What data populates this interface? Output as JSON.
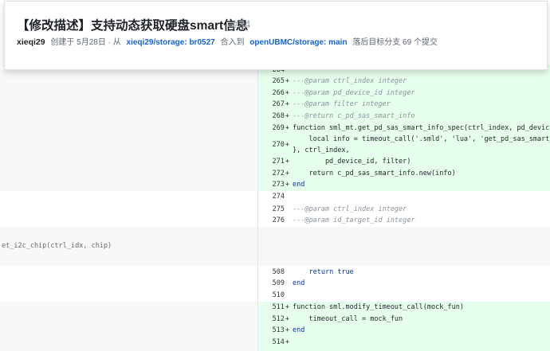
{
  "pr": {
    "title": "【修改描述】支持动态获取硬盘smart信息",
    "number": "#34",
    "author": "xieqi29",
    "created": "创建于 5月28日 · 从",
    "source_branch": "xieqi29/storage: br0527",
    "merge_into": "合入到",
    "target_branch": "openUBMC/storage: main",
    "behind": "落后目标分支 69 个提交"
  },
  "left_code": "et_i2c_chip(ctrl_idx, chip)",
  "hunk1": [
    {
      "ln": "265",
      "code": "---@param ctrl_index integer",
      "type": "comment"
    },
    {
      "ln": "266",
      "code": "---@param pd_device_id integer",
      "type": "comment"
    },
    {
      "ln": "267",
      "code": "---@param filter integer",
      "type": "comment"
    },
    {
      "ln": "268",
      "code": "---@return c_pd_sas_smart_info",
      "type": "comment"
    },
    {
      "ln": "269",
      "code": "function sml_mt.get_pd_sas_smart_info_spec(ctrl_index, pd_device_id, filter)",
      "type": "code"
    },
    {
      "ln": "270",
      "code": "    local info = timeout_call('.smld', 'lua', 'get_pd_sas_smart_info_spec'",
      "code2": "}, ctrl_index,",
      "type": "code"
    },
    {
      "ln": "271",
      "code": "        pd_device_id, filter)",
      "type": "code"
    },
    {
      "ln": "272",
      "code": "    return c_pd_sas_smart_info.new(info)",
      "type": "code"
    },
    {
      "ln": "273",
      "code": "end",
      "type": "code"
    }
  ],
  "context1": [
    {
      "ln": "274",
      "code": ""
    },
    {
      "ln": "275",
      "code": "---@param ctrl_index integer",
      "type": "comment"
    },
    {
      "ln": "276",
      "code": "---@param id_target_id integer",
      "type": "comment"
    }
  ],
  "context2": [
    {
      "ln": "508",
      "code": "    return true"
    },
    {
      "ln": "509",
      "code": "end"
    },
    {
      "ln": "510",
      "code": ""
    }
  ],
  "hunk2": [
    {
      "ln": "511",
      "code": "function sml.modify_timeout_call(mock_fun)"
    },
    {
      "ln": "512",
      "code": "    timeout_call = mock_fun"
    },
    {
      "ln": "513",
      "code": "end"
    },
    {
      "ln": "514",
      "code": ""
    }
  ],
  "colors": {
    "added_bg": "#e6ffec",
    "context_bg": "#f7f8fa",
    "link": "#1462d6",
    "keyword": "#0033b3"
  }
}
